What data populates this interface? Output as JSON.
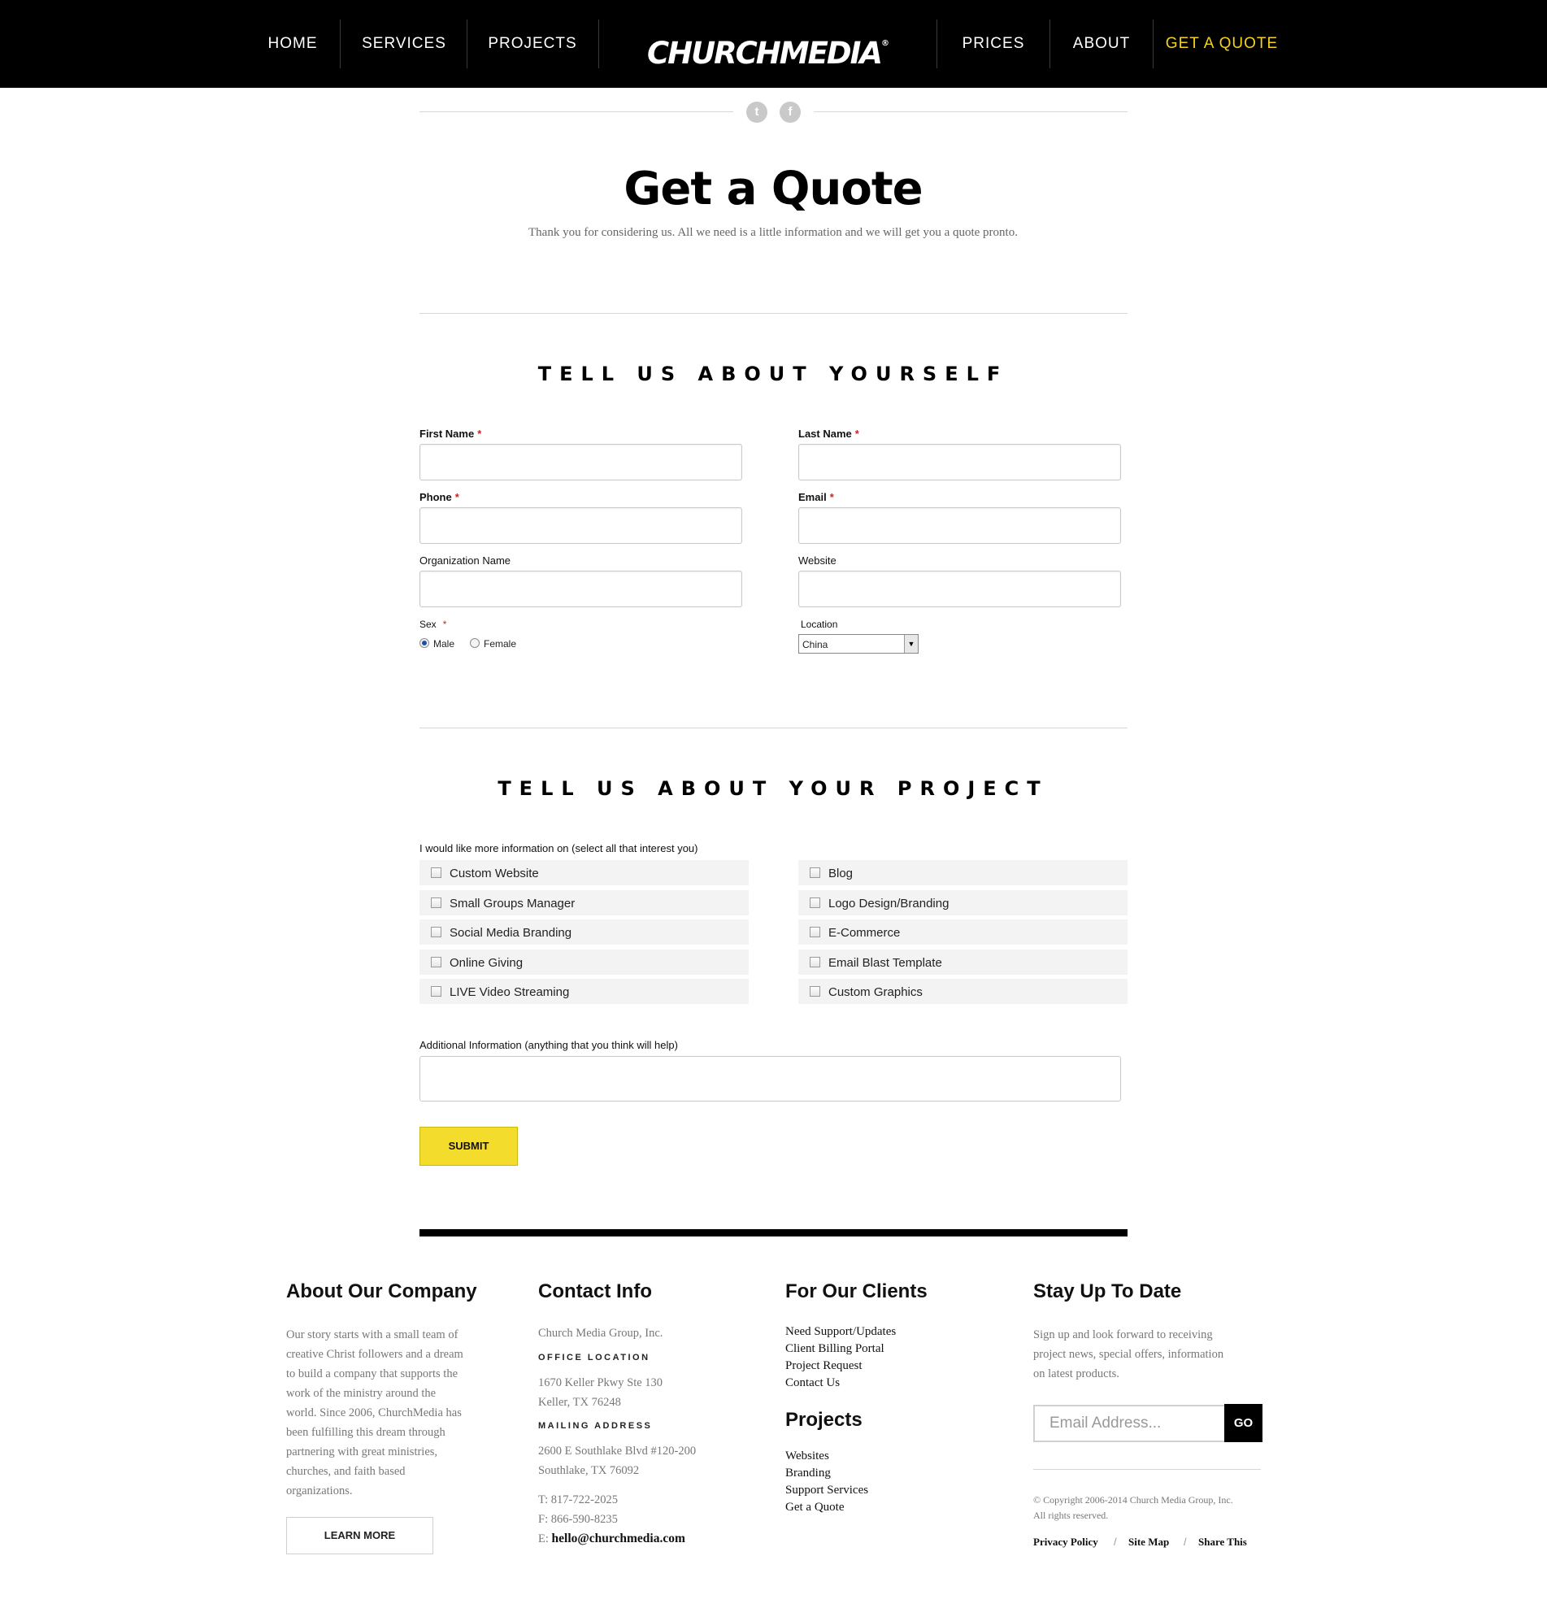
{
  "nav": {
    "home": "HOME",
    "services": "SERVICES",
    "projects": "PROJECTS",
    "prices": "PRICES",
    "about": "ABOUT",
    "quote": "GET A QUOTE",
    "logo": "CHURCHMEDIA",
    "logo_mark": "®"
  },
  "social": {
    "twitter": "t",
    "facebook": "f"
  },
  "page": {
    "title": "Get a Quote",
    "subtitle": "Thank you for considering us. All we need is a little information and we will get you a quote pronto."
  },
  "section1": {
    "heading": "TELL US ABOUT YOURSELF",
    "first_name": "First Name",
    "last_name": "Last Name",
    "phone": "Phone",
    "email": "Email",
    "organization": "Organization Name",
    "website": "Website",
    "sex": "Sex",
    "male": "Male",
    "female": "Female",
    "location": "Location",
    "location_value": "China",
    "required_mark": "*"
  },
  "section2": {
    "heading": "TELL US ABOUT YOUR PROJECT",
    "intro": "I would like more information on (select all that interest you)",
    "left_options": [
      "Custom Website",
      "Small Groups Manager",
      "Social Media Branding",
      "Online Giving",
      "LIVE Video Streaming"
    ],
    "right_options": [
      "Blog",
      "Logo Design/Branding",
      "E-Commerce",
      "Email Blast Template",
      "Custom Graphics"
    ],
    "additional": "Additional Information (anything that you think will help)",
    "submit": "SUBMIT"
  },
  "footer": {
    "about": {
      "heading": "About Our Company",
      "lines": [
        "Our story starts with a small team of",
        "creative Christ followers and a dream",
        "to build a company that supports the",
        "work of the ministry around the",
        "world. Since 2006, ChurchMedia has",
        "been fulfilling this dream through",
        "partnering with great ministries,",
        "churches, and faith based",
        "organizations."
      ],
      "button": "LEARN MORE"
    },
    "contact": {
      "heading": "Contact Info",
      "company": "Church Media Group, Inc.",
      "office_label": "OFFICE LOCATION",
      "office_line1": "1670 Keller Pkwy Ste 130",
      "office_line2": "Keller, TX 76248",
      "mailing_label": "MAILING ADDRESS",
      "mailing_line1": "2600 E Southlake Blvd #120-200",
      "mailing_line2": "Southlake, TX 76092",
      "phone": "T: 817-722-2025",
      "fax": "F: 866-590-8235",
      "email_prefix": "E: ",
      "email": "hello@churchmedia.com"
    },
    "clients": {
      "heading": "For Our Clients",
      "links": [
        "Need Support/Updates",
        "Client Billing Portal",
        "Project Request",
        "Contact Us"
      ]
    },
    "projects": {
      "heading": "Projects",
      "links": [
        "Websites",
        "Branding",
        "Support Services",
        "Get a Quote"
      ]
    },
    "updates": {
      "heading": "Stay Up To Date",
      "lines": [
        "Sign up and look forward to receiving",
        "project news, special offers, information",
        "on latest products."
      ],
      "email_placeholder": "Email Address...",
      "go": "GO",
      "copyright1": "© Copyright 2006-2014 Church Media Group, Inc.",
      "copyright2": "All rights reserved.",
      "privacy": "Privacy Policy",
      "sitemap": "Site Map",
      "share": "Share This",
      "sep": "/"
    }
  },
  "colors": {
    "accent": "#f3d21c",
    "nav_bg": "#000000",
    "required": "#cc2222"
  }
}
